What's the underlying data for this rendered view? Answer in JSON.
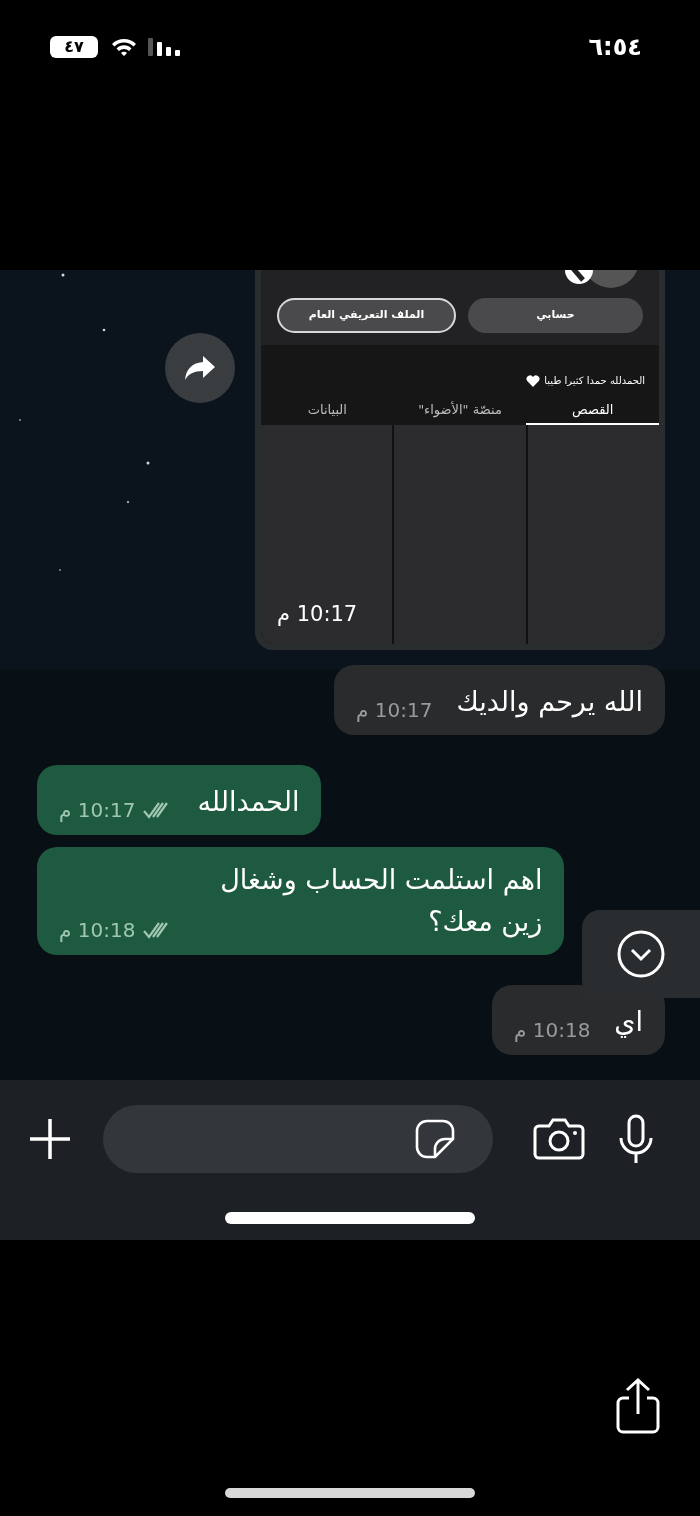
{
  "status_bar": {
    "time": "٦:٥٤",
    "battery": "٤٧"
  },
  "chat": {
    "image_message": {
      "buttons": [
        {
          "label": "حسابي",
          "kind": "filled"
        },
        {
          "label": "الملف التعريفي العام",
          "kind": "outlined"
        }
      ],
      "bio": "الحمدلله حمدا كثيرا طيبا",
      "tabs": [
        {
          "label": "القصص",
          "selected": true
        },
        {
          "label": "منصّة \"الأضواء\"",
          "selected": false
        },
        {
          "label": "البيانات",
          "selected": false
        }
      ],
      "time": "10:17 م"
    },
    "messages": [
      {
        "kind": "received",
        "text": "الله يرحم والديك",
        "time": "10:17 م"
      },
      {
        "kind": "sent",
        "text": "الحمدالله",
        "time": "10:17 م",
        "read": true
      },
      {
        "kind": "sent",
        "text": "اهم استلمت الحساب وشغال زين معك؟",
        "time": "10:18 م",
        "read": true
      },
      {
        "kind": "received",
        "text": "اي",
        "time": "10:18 م"
      }
    ]
  }
}
